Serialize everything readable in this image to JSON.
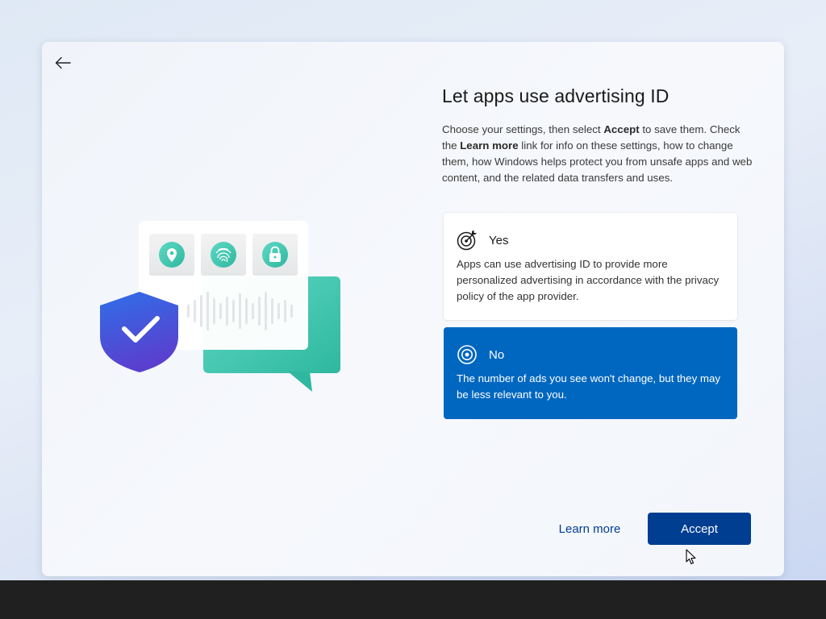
{
  "page": {
    "title": "Let apps use advertising ID",
    "description": {
      "part1": "Choose your settings, then select ",
      "accept_word": "Accept",
      "part2": " to save them. Check the ",
      "learn_more_word": "Learn more",
      "part3": " link for info on these settings, how to change them, how Windows helps protect you from unsafe apps and web content, and the related data transfers and uses."
    }
  },
  "options": {
    "yes": {
      "label": "Yes",
      "description": "Apps can use advertising ID to provide more personalized advertising in accordance with the privacy policy of the app provider.",
      "icon": "target-icon",
      "selected": false
    },
    "no": {
      "label": "No",
      "description": "The number of ads you see won't change, but they may be less relevant to you.",
      "icon": "radio-selected-icon",
      "selected": true
    }
  },
  "actions": {
    "learn_more": "Learn more",
    "accept": "Accept"
  },
  "navigation": {
    "back_icon": "back-arrow-icon"
  },
  "illustration": {
    "icons": [
      "location-pin-icon",
      "fingerprint-icon",
      "lock-icon",
      "shield-check-icon"
    ]
  },
  "colors": {
    "accent": "#0067c0",
    "button": "#003e92",
    "illustration_teal": "#3ec8b2",
    "shield_blue": "#3f5fd9",
    "taskbar": "#202020"
  }
}
